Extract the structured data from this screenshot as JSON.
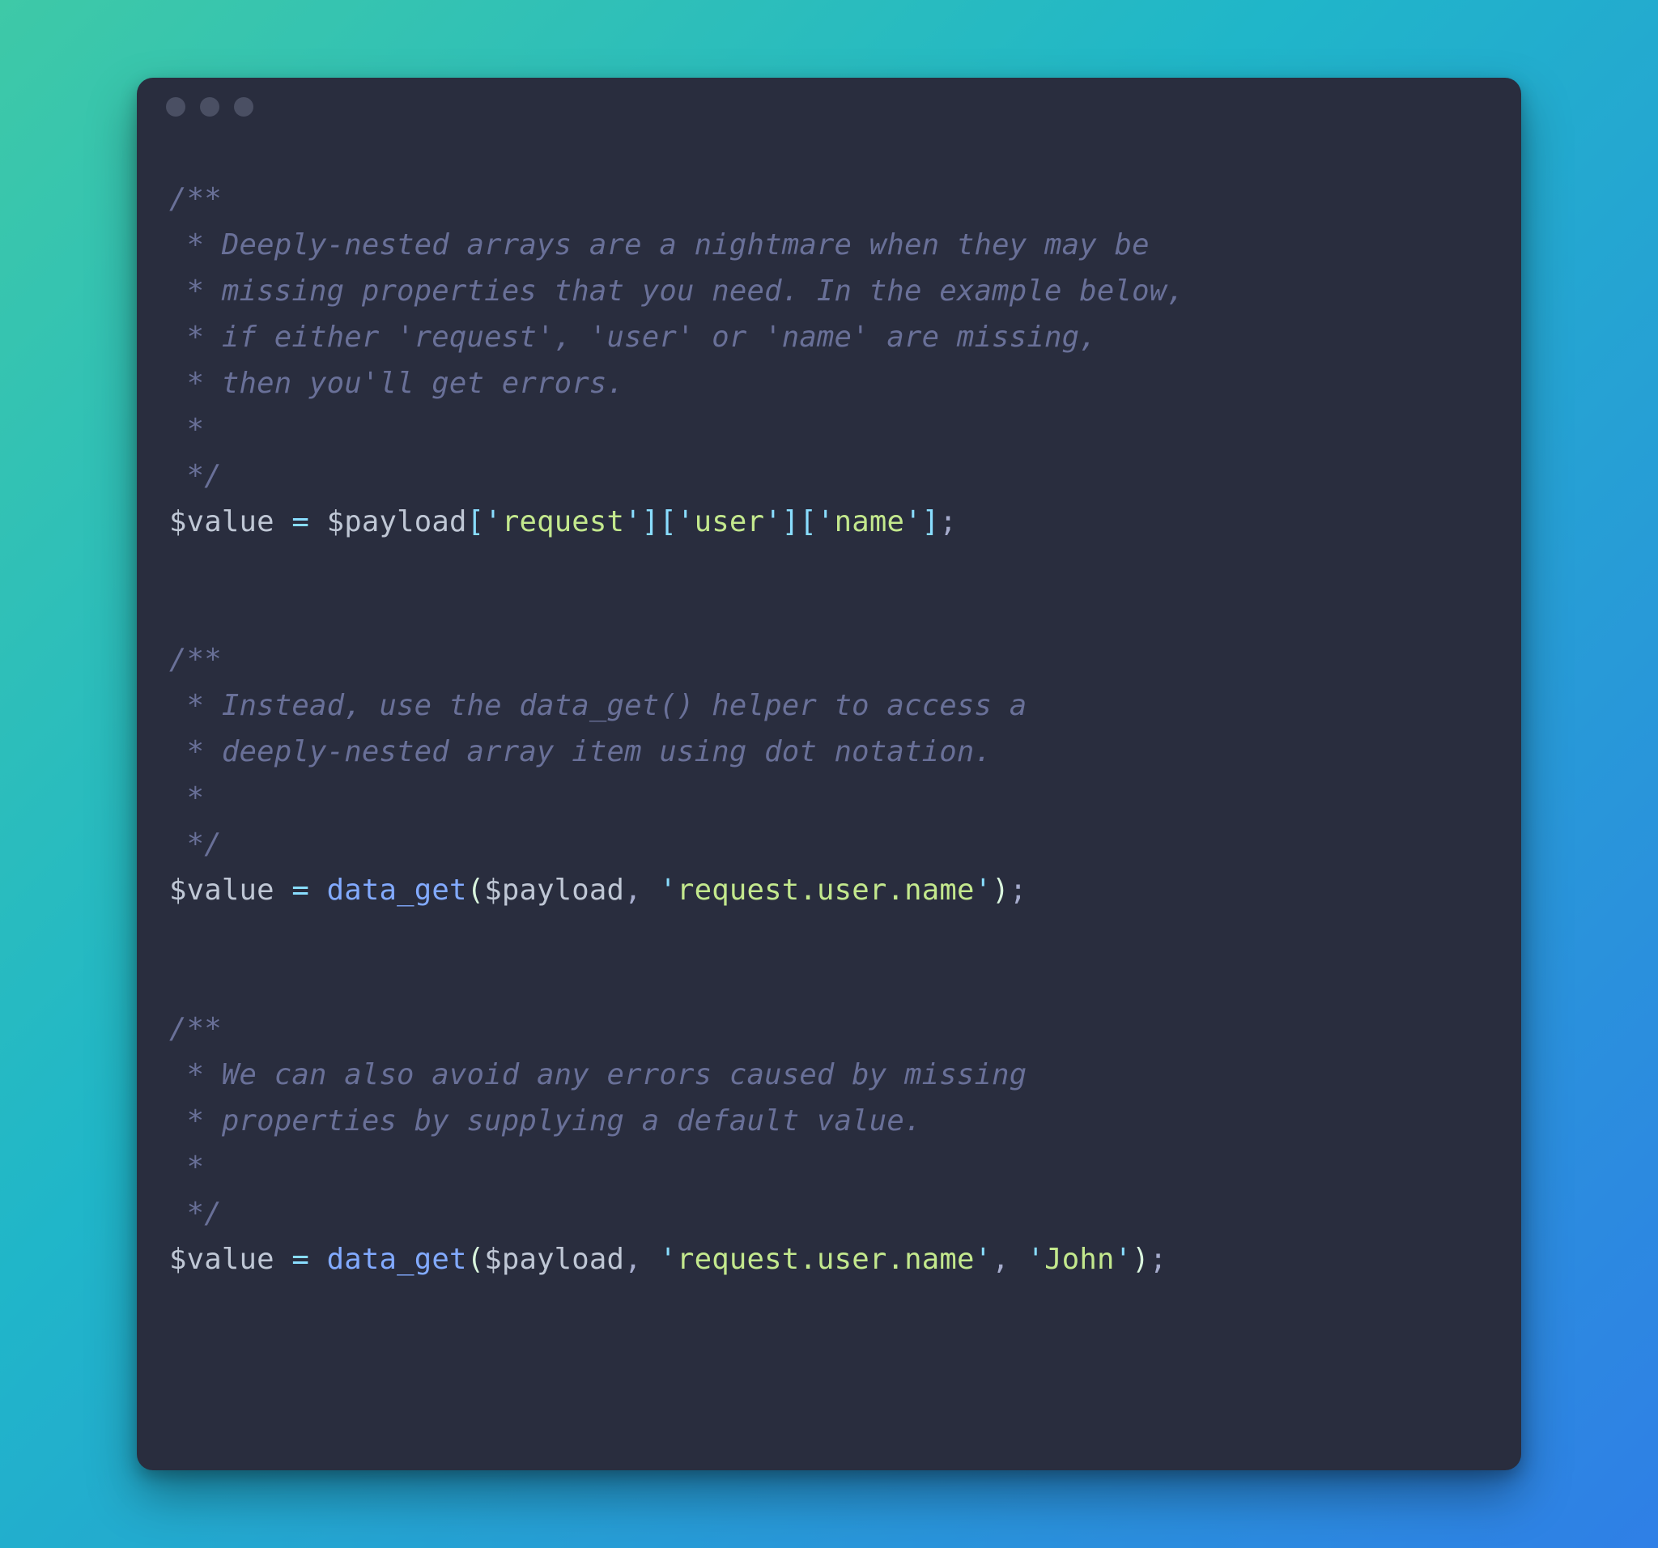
{
  "colors": {
    "editorBg": "#292D3E",
    "comment": "#697098",
    "variable": "#BFC7D5",
    "operator": "#89DDFF",
    "string": "#C3E88D",
    "function": "#82AAFF",
    "default": "#A6ACCD",
    "punct": "#D9F5DD",
    "dot": "#4a4f63"
  },
  "window": {
    "dots": 3
  },
  "code": {
    "block1": {
      "c0": "/**",
      "c1": " * Deeply-nested arrays are a nightmare when they may be",
      "c2": " * missing properties that you need. In the example below,",
      "c3": " * if either 'request', 'user' or 'name' are missing,",
      "c4": " * then you'll get errors.",
      "c5": " *",
      "c6": " */",
      "var_value": "$value",
      "eq": " = ",
      "var_payload": "$payload",
      "lb1": "[",
      "q": "'",
      "key_request": "request",
      "rb1": "]",
      "lb2": "[",
      "key_user": "user",
      "rb2": "]",
      "lb3": "[",
      "key_name": "name",
      "rb3": "]",
      "semi": ";"
    },
    "block2": {
      "c0": "/**",
      "c1": " * Instead, use the data_get() helper to access a",
      "c2": " * deeply-nested array item using dot notation.",
      "c3": " *",
      "c4": " */",
      "var_value": "$value",
      "eq": " = ",
      "func": "data_get",
      "lp": "(",
      "var_payload": "$payload",
      "comma": ", ",
      "q": "'",
      "arg_path": "request.user.name",
      "rp": ")",
      "semi": ";"
    },
    "block3": {
      "c0": "/**",
      "c1": " * We can also avoid any errors caused by missing",
      "c2": " * properties by supplying a default value.",
      "c3": " *",
      "c4": " */",
      "var_value": "$value",
      "eq": " = ",
      "func": "data_get",
      "lp": "(",
      "var_payload": "$payload",
      "comma1": ", ",
      "q": "'",
      "arg_path": "request.user.name",
      "comma2": ", ",
      "arg_default": "John",
      "rp": ")",
      "semi": ";"
    }
  }
}
